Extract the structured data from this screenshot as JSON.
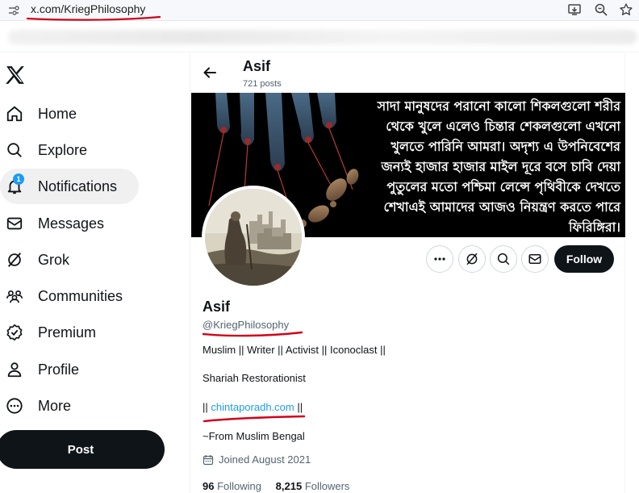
{
  "browser": {
    "url": "x.com/KriegPhilosophy",
    "toolbar_icons": [
      "install-app-icon",
      "zoom-icon",
      "bookmark-star-icon"
    ]
  },
  "sidebar": {
    "items": [
      {
        "label": "Home",
        "icon": "home-icon"
      },
      {
        "label": "Explore",
        "icon": "search-icon"
      },
      {
        "label": "Notifications",
        "icon": "bell-icon",
        "badge": "1"
      },
      {
        "label": "Messages",
        "icon": "envelope-icon"
      },
      {
        "label": "Grok",
        "icon": "grok-icon"
      },
      {
        "label": "Communities",
        "icon": "communities-icon"
      },
      {
        "label": "Premium",
        "icon": "verified-icon"
      },
      {
        "label": "Profile",
        "icon": "person-icon"
      },
      {
        "label": "More",
        "icon": "more-circle-icon"
      }
    ],
    "post_label": "Post"
  },
  "header": {
    "name": "Asif",
    "posts": "721 posts"
  },
  "banner": {
    "quote": "সাদা মানুষদের পরানো কালো শিকলগুলো শরীর থেকে খুলে এলেও চিন্তার শেকলগুলো এখনো খুলতে পারিনি আমরা। অদৃশ্য এ উপনিবেশের জন্যই হাজার হাজার মাইল দূরে বসে চাবি দেয়া পুতুলের মতো পশ্চিমা লেন্সে পৃথিবীকে দেখতে শেখাএই আমাদের আজও নিয়ন্ত্রণ করতে পারে ফিরিঙ্গিরা।"
  },
  "profile": {
    "name": "Asif",
    "handle": "@KriegPhilosophy",
    "follow_label": "Follow",
    "bio_line1": "Muslim || Writer || Activist || Iconoclast ||",
    "bio_line2": "Shariah Restorationist",
    "link_prefix": "|| ",
    "link_text": "chintaporadh.com",
    "link_suffix": " ||",
    "bio_line4": "~From Muslim Bengal",
    "joined": "Joined August 2021",
    "following_count": "96",
    "following_label": "Following",
    "followers_count": "8,215",
    "followers_label": "Followers"
  },
  "colors": {
    "accent": "#1d9bf0",
    "annotation": "#d0021b"
  }
}
